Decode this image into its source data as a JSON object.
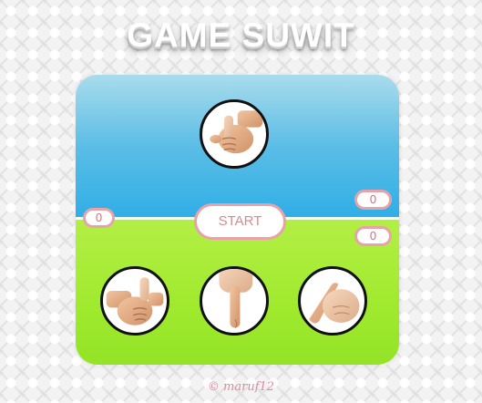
{
  "game": {
    "title": "GAME SUWIT",
    "start_label": "START",
    "footer": "© maruf12"
  },
  "scores": {
    "player": "0",
    "computer": "0",
    "draw": "0"
  },
  "computer_choice": "thumb-hand-icon",
  "player_choices": [
    {
      "name": "thumb",
      "icon": "thumb-hand-icon"
    },
    {
      "name": "index-finger",
      "icon": "index-finger-hand-icon"
    },
    {
      "name": "pinky",
      "icon": "pinky-hand-icon"
    }
  ],
  "colors": {
    "sky_top": "#a9dcec",
    "sky_bottom": "#2faee6",
    "grass": "#a0ea2e",
    "pill_border": "#e8a3a8",
    "pill_text": "#c4747c",
    "footer_text": "#e08aa0"
  }
}
